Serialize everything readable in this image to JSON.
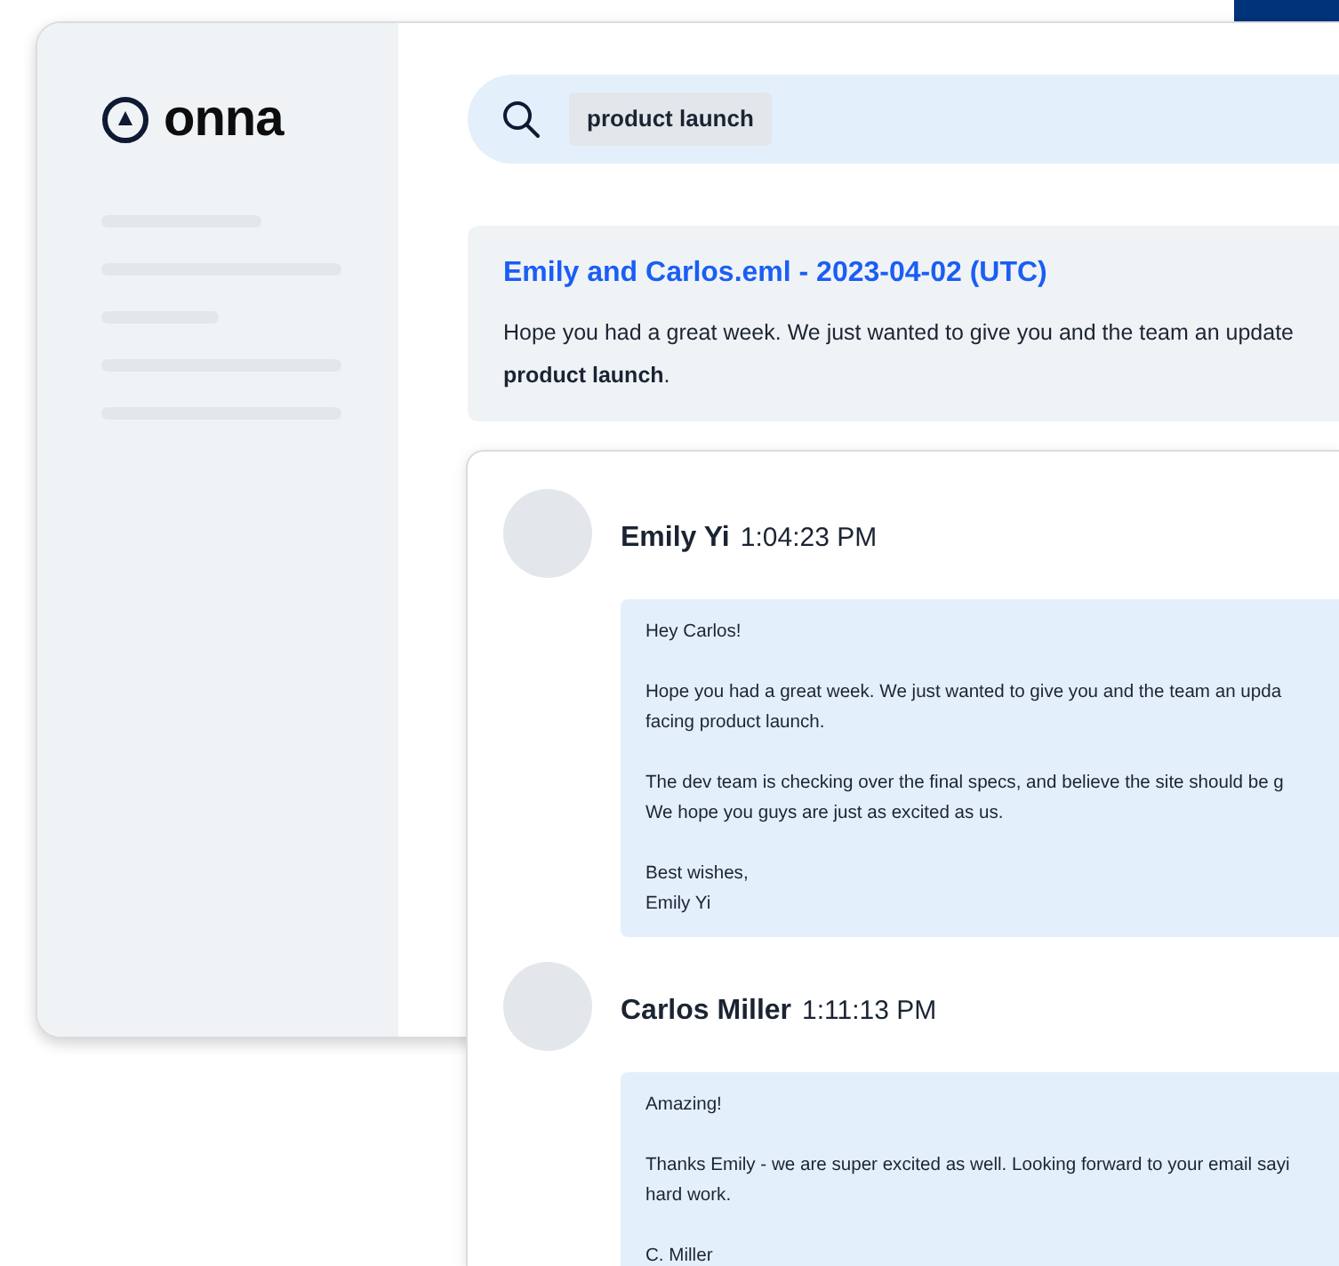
{
  "logo": {
    "text": "onna"
  },
  "search": {
    "query": "product launch"
  },
  "result": {
    "title": "Emily and Carlos.eml - 2023-04-02 (UTC)",
    "snippet": [
      "Hope you had a great week. We just wanted to give you and the team an update",
      "**product launch**."
    ]
  },
  "messages": [
    {
      "sender": "Emily Yi",
      "time": "1:04:23 PM",
      "paragraphs": [
        [
          "Hey Carlos!"
        ],
        [
          "Hope you had a great week. We just wanted to give you and the team an upda",
          "facing product launch."
        ],
        [
          "The dev team is checking over the final specs, and believe the site should be g",
          "We hope you guys are just as excited as us."
        ],
        [
          "Best wishes,",
          "Emily Yi"
        ]
      ]
    },
    {
      "sender": "Carlos Miller",
      "time": "1:11:13 PM",
      "paragraphs": [
        [
          "Amazing!"
        ],
        [
          "Thanks Emily - we are super excited as well. Looking forward to your email sayi",
          "hard work."
        ],
        [
          "C. Miller"
        ]
      ]
    }
  ]
}
